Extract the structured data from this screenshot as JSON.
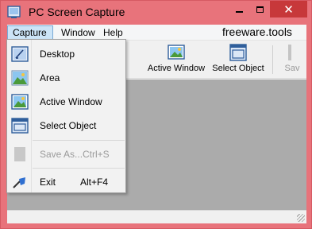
{
  "window": {
    "title": "PC Screen Capture"
  },
  "titlebar": {
    "min_icon": "minimize-icon",
    "max_icon": "maximize-icon",
    "close_label": "✕"
  },
  "menubar": {
    "items": [
      "Capture",
      "Window",
      "Help"
    ],
    "site": "freeware.tools"
  },
  "toolbar": {
    "active_window": "Active Window",
    "select_object": "Select Object",
    "save": "Sav"
  },
  "menu": {
    "desktop": "Desktop",
    "area": "Area",
    "active_window": "Active Window",
    "select_object": "Select Object",
    "save_as": "Save As...",
    "save_as_key": "Ctrl+S",
    "exit": "Exit",
    "exit_key": "Alt+F4"
  },
  "colors": {
    "frame": "#e8737b",
    "close": "#c7383a",
    "canvas": "#ababab",
    "menu_highlight": "#cce4f7"
  }
}
